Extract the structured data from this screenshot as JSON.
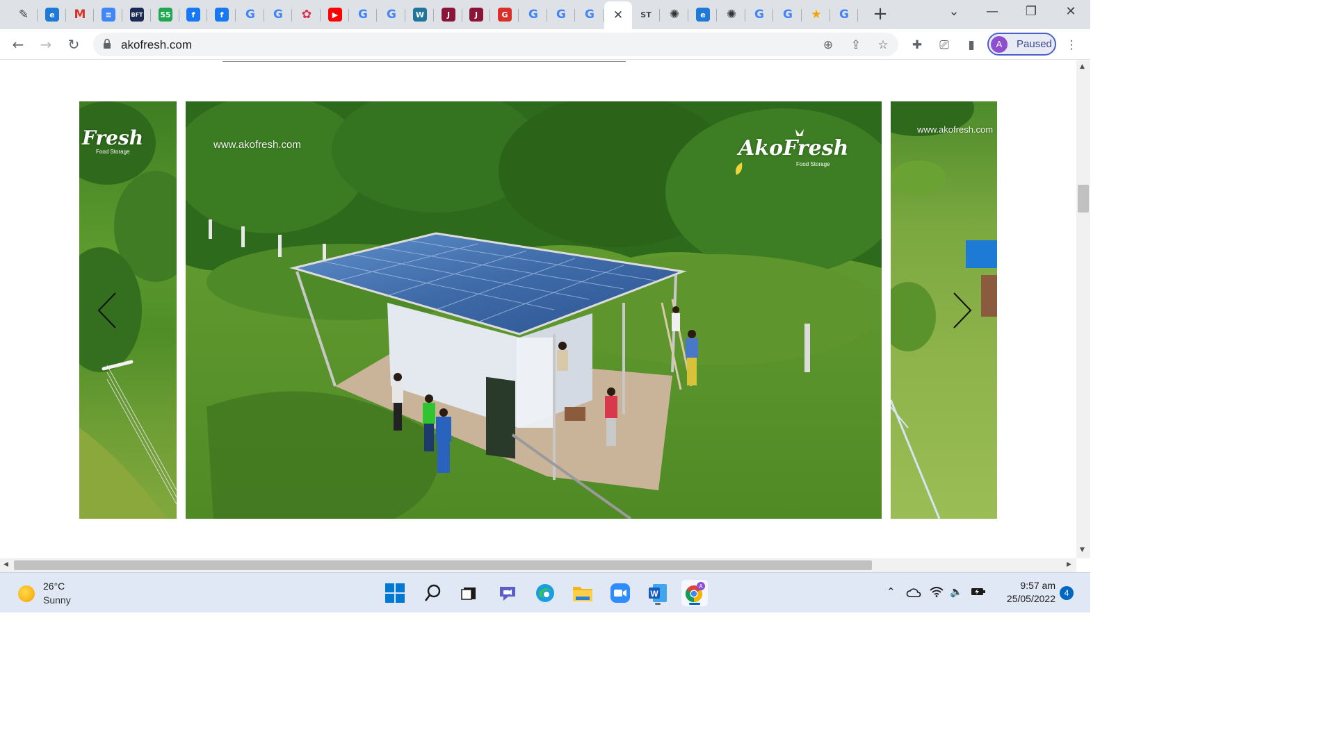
{
  "browser": {
    "tabs": [
      {
        "icon": "quill-icon",
        "glyph": "✎",
        "color": "#444444",
        "bg": "transparent"
      },
      {
        "icon": "ie-icon",
        "glyph": "e",
        "color": "#ffffff",
        "bg": "#1e7ad6"
      },
      {
        "icon": "gmail-icon",
        "glyph": "M",
        "color": "#d93025",
        "bg": "transparent"
      },
      {
        "icon": "docs-icon",
        "glyph": "≡",
        "color": "#ffffff",
        "bg": "#4285f4"
      },
      {
        "icon": "bft-icon",
        "glyph": "BFT",
        "color": "#ffffff",
        "bg": "#1b2a55"
      },
      {
        "icon": "badge-icon",
        "glyph": "55",
        "color": "#ffffff",
        "bg": "#1fa84f"
      },
      {
        "icon": "facebook-icon",
        "glyph": "f",
        "color": "#ffffff",
        "bg": "#1877f2"
      },
      {
        "icon": "facebook-icon",
        "glyph": "f",
        "color": "#ffffff",
        "bg": "#1877f2"
      },
      {
        "icon": "google-icon",
        "glyph": "G",
        "color": "#4285f4",
        "bg": "transparent"
      },
      {
        "icon": "google-icon",
        "glyph": "G",
        "color": "#4285f4",
        "bg": "transparent"
      },
      {
        "icon": "shield-icon",
        "glyph": "✿",
        "color": "#d9304a",
        "bg": "transparent"
      },
      {
        "icon": "youtube-icon",
        "glyph": "▶",
        "color": "#ffffff",
        "bg": "#ff0000"
      },
      {
        "icon": "google-icon",
        "glyph": "G",
        "color": "#4285f4",
        "bg": "transparent"
      },
      {
        "icon": "google-icon",
        "glyph": "G",
        "color": "#4285f4",
        "bg": "transparent"
      },
      {
        "icon": "wordpress-icon",
        "glyph": "W",
        "color": "#ffffff",
        "bg": "#21759b"
      },
      {
        "icon": "joy-online-icon",
        "glyph": "J",
        "color": "#ffffff",
        "bg": "#8a1538"
      },
      {
        "icon": "joy-online-icon",
        "glyph": "J",
        "color": "#ffffff",
        "bg": "#8a1538"
      },
      {
        "icon": "grammarly-icon",
        "glyph": "G",
        "color": "#ffffff",
        "bg": "#d9302c"
      },
      {
        "icon": "google-icon",
        "glyph": "G",
        "color": "#4285f4",
        "bg": "transparent"
      },
      {
        "icon": "google-icon",
        "glyph": "G",
        "color": "#4285f4",
        "bg": "transparent"
      },
      {
        "icon": "google-icon",
        "glyph": "G",
        "color": "#4285f4",
        "bg": "transparent"
      },
      {
        "icon": "close-icon",
        "glyph": "✕",
        "color": "#3c4043",
        "bg": "transparent",
        "active": true
      },
      {
        "icon": "st-icon",
        "glyph": "ST",
        "color": "#444444",
        "bg": "transparent"
      },
      {
        "icon": "openai-icon",
        "glyph": "✺",
        "color": "#333333",
        "bg": "transparent"
      },
      {
        "icon": "ie-icon",
        "glyph": "e",
        "color": "#ffffff",
        "bg": "#1e7ad6"
      },
      {
        "icon": "openai-icon",
        "glyph": "✺",
        "color": "#333333",
        "bg": "transparent"
      },
      {
        "icon": "google-icon",
        "glyph": "G",
        "color": "#4285f4",
        "bg": "transparent"
      },
      {
        "icon": "google-icon",
        "glyph": "G",
        "color": "#4285f4",
        "bg": "transparent"
      },
      {
        "icon": "star-burst-icon",
        "glyph": "★",
        "color": "#f5a300",
        "bg": "transparent"
      },
      {
        "icon": "google-icon",
        "glyph": "G",
        "color": "#4285f4",
        "bg": "transparent"
      }
    ],
    "url": "akofresh.com",
    "profile_initial": "A",
    "profile_status": "Paused"
  },
  "carousel": {
    "watermark_url": "www.akofresh.com",
    "logo_text": "AkoFresh",
    "logo_sub": "Food Storage",
    "left_logo_text": "Fresh",
    "left_logo_sub": "Food Storage",
    "right_watermark_url": "www.akofresh.com"
  },
  "taskbar": {
    "weather_temp": "26°C",
    "weather_cond": "Sunny",
    "clock_time": "9:57 am",
    "clock_date": "25/05/2022",
    "notification_count": "4"
  }
}
